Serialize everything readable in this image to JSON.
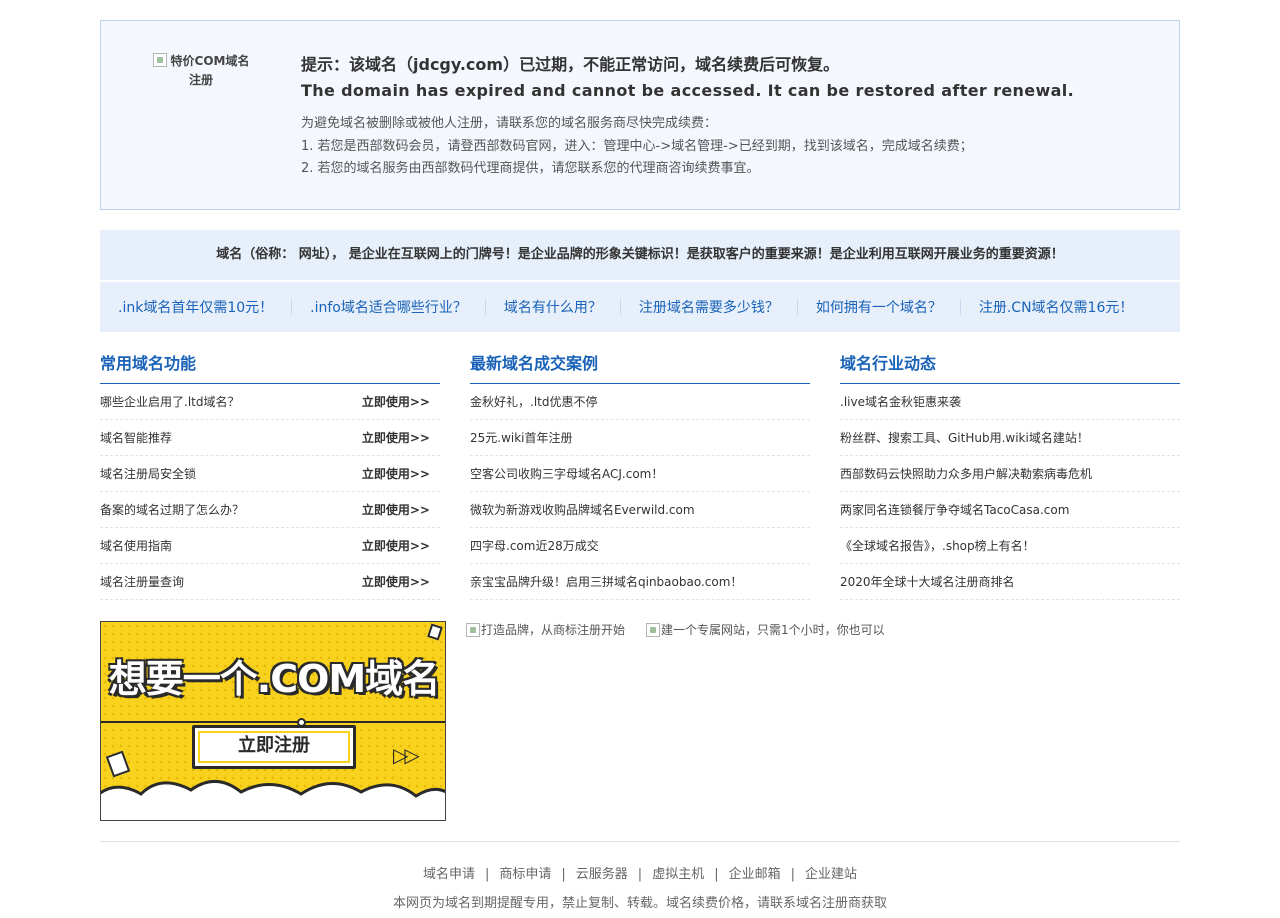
{
  "notice": {
    "promo_alt": "特价COM域名注册",
    "tip_cn": "提示：该域名（jdcgy.com）已过期，不能正常访问，域名续费后可恢复。",
    "tip_en": "The domain has expired and cannot be accessed. It can be restored after renewal.",
    "lines": [
      "为避免域名被删除或被他人注册，请联系您的域名服务商尽快完成续费：",
      "1. 若您是西部数码会员，请登西部数码官网，进入：管理中心->域名管理->已经到期，找到该域名，完成域名续费；",
      "2. 若您的域名服务由西部数码代理商提供，请您联系您的代理商咨询续费事宜。"
    ]
  },
  "slogan": "域名（俗称： 网址）， 是企业在互联网上的门牌号！是企业品牌的形象关键标识！是获取客户的重要来源！是企业利用互联网开展业务的重要资源！",
  "quicklinks": [
    ".ink域名首年仅需10元！",
    ".info域名适合哪些行业？",
    "域名有什么用？",
    "注册域名需要多少钱？",
    "如何拥有一个域名？",
    "注册.CN域名仅需16元！"
  ],
  "columns": [
    {
      "title": "常用域名功能",
      "action_label": "立即使用>>",
      "items": [
        "哪些企业启用了.ltd域名？",
        "域名智能推荐",
        "域名注册局安全锁",
        "备案的域名过期了怎么办？",
        "域名使用指南",
        "域名注册量查询"
      ]
    },
    {
      "title": "最新域名成交案例",
      "items": [
        "金秋好礼，.ltd优惠不停",
        "25元.wiki首年注册",
        "空客公司收购三字母域名ACJ.com！",
        "微软为新游戏收购品牌域名Everwild.com",
        "四字母.com近28万成交",
        "亲宝宝品牌升级！启用三拼域名qinbaobao.com！"
      ]
    },
    {
      "title": "域名行业动态",
      "items": [
        ".live域名金秋钜惠来袭",
        "粉丝群、搜索工具、GitHub用.wiki域名建站！",
        "西部数码云快照助力众多用户解决勒索病毒危机",
        "两家同名连锁餐厅争夺域名TacoCasa.com",
        "《全球域名报告》，.shop榜上有名！",
        "2020年全球十大域名注册商排名"
      ]
    }
  ],
  "banner": {
    "headline": "想要一个.COM域名",
    "button": "立即注册",
    "arrows": "▷▷"
  },
  "image_alts": [
    "打造品牌，从商标注册开始",
    "建一个专属网站，只需1个小时，你也可以"
  ],
  "footer": {
    "links": [
      "域名申请",
      "商标申请",
      "云服务器",
      "虚拟主机",
      "企业邮箱",
      "企业建站"
    ],
    "separator": "|",
    "note": "本网页为域名到期提醒专用，禁止复制、转载。域名续费价格，请联系域名注册商获取"
  }
}
